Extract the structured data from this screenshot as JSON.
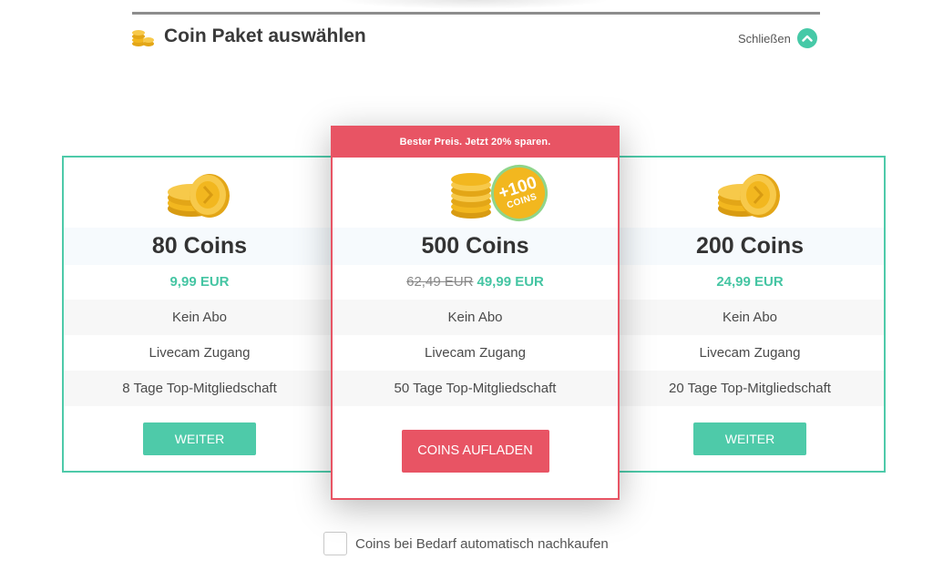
{
  "header": {
    "title": "Coin Paket auswählen",
    "close_label": "Schließen"
  },
  "colors": {
    "accent_green": "#4ecaa9",
    "accent_red": "#e85464",
    "coin_gold": "#f2b71f"
  },
  "packages": [
    {
      "coins_label": "80 Coins",
      "price": "9,99 EUR",
      "features": [
        "Kein Abo",
        "Livecam Zugang",
        "8 Tage Top-Mitgliedschaft"
      ],
      "button": "WEITER"
    },
    {
      "promo": "Bester Preis. Jetzt 20% sparen.",
      "bonus_amount": "+100",
      "bonus_unit": "COINS",
      "coins_label": "500 Coins",
      "old_price": "62,49 EUR",
      "price": "49,99 EUR",
      "features": [
        "Kein Abo",
        "Livecam Zugang",
        "50 Tage Top-Mitgliedschaft"
      ],
      "button": "COINS AUFLADEN"
    },
    {
      "coins_label": "200 Coins",
      "price": "24,99 EUR",
      "features": [
        "Kein Abo",
        "Livecam Zugang",
        "20 Tage Top-Mitgliedschaft"
      ],
      "button": "WEITER"
    }
  ],
  "auto_buy": {
    "label": "Coins bei Bedarf automatisch nachkaufen",
    "checked": false
  }
}
